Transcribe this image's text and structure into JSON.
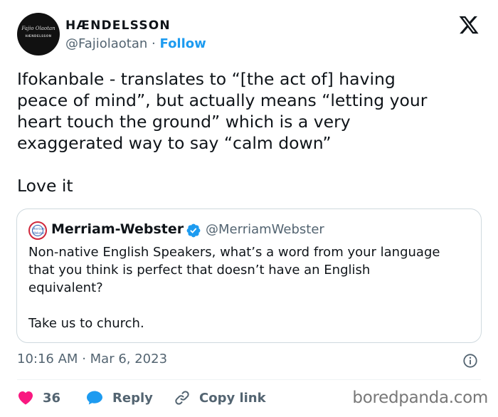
{
  "author": {
    "display_name": "HÆNDELSSON",
    "handle": "@Fajiolaotan",
    "separator": "·",
    "follow_label": "Follow",
    "avatar_signature": "Fajio Olaotan",
    "avatar_brand": "HÆNDELSSON"
  },
  "tweet": {
    "lines": [
      "Ifokanbale - translates to “[the act of] having",
      "peace of mind”, but actually means “letting your",
      "heart touch the ground” which is a very",
      "exaggerated way to say “calm down”"
    ],
    "closing": "Love it"
  },
  "quoted": {
    "display_name": "Merriam-Webster",
    "handle": "@MerriamWebster",
    "avatar_text": "Merriam Webster",
    "lines": [
      "Non-native English Speakers, what’s a word from your language",
      "that you think is perfect that doesn’t have an English",
      "equivalent?"
    ],
    "closing": "Take us to church."
  },
  "meta": {
    "time": "10:16 AM",
    "separator": "·",
    "date": "Mar 6, 2023"
  },
  "actions": {
    "like_count": "36",
    "reply_label": "Reply",
    "copy_label": "Copy link"
  },
  "watermark": "boredpanda.com",
  "colors": {
    "accent": "#1d9bf0",
    "like": "#f91880",
    "text": "#0f1419",
    "muted": "#536471",
    "border": "#cfd9de"
  },
  "icons": [
    "x-logo-icon",
    "verified-badge-icon",
    "info-icon",
    "heart-icon",
    "reply-icon",
    "link-icon"
  ]
}
